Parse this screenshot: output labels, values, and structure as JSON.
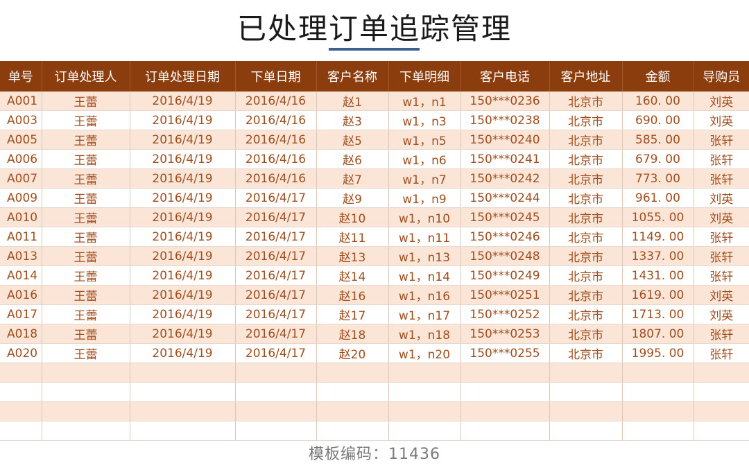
{
  "title": "已处理订单追踪管理",
  "colors": {
    "header_bg": "#8c3d0e",
    "band": "#fbe5d6",
    "text": "#a14e1e",
    "accent_underline": "#3d5f8e"
  },
  "table": {
    "headers": [
      "单号",
      "订单处理人",
      "订单处理日期",
      "下单日期",
      "客户名称",
      "下单明细",
      "客户电话",
      "客户地址",
      "金额",
      "导购员"
    ],
    "rows": [
      [
        "A001",
        "王蕾",
        "2016/4/19",
        "2016/4/16",
        "赵1",
        "w1，n1",
        "150***0236",
        "北京市",
        "160. 00",
        "刘英"
      ],
      [
        "A003",
        "王蕾",
        "2016/4/19",
        "2016/4/16",
        "赵3",
        "w1，n3",
        "150***0238",
        "北京市",
        "690. 00",
        "刘英"
      ],
      [
        "A005",
        "王蕾",
        "2016/4/19",
        "2016/4/16",
        "赵5",
        "w1，n5",
        "150***0240",
        "北京市",
        "585. 00",
        "张轩"
      ],
      [
        "A006",
        "王蕾",
        "2016/4/19",
        "2016/4/16",
        "赵6",
        "w1，n6",
        "150***0241",
        "北京市",
        "679. 00",
        "张轩"
      ],
      [
        "A007",
        "王蕾",
        "2016/4/19",
        "2016/4/16",
        "赵7",
        "w1，n7",
        "150***0242",
        "北京市",
        "773. 00",
        "张轩"
      ],
      [
        "A009",
        "王蕾",
        "2016/4/19",
        "2016/4/17",
        "赵9",
        "w1，n9",
        "150***0244",
        "北京市",
        "961. 00",
        "刘英"
      ],
      [
        "A010",
        "王蕾",
        "2016/4/19",
        "2016/4/17",
        "赵10",
        "w1，n10",
        "150***0245",
        "北京市",
        "1055. 00",
        "刘英"
      ],
      [
        "A011",
        "王蕾",
        "2016/4/19",
        "2016/4/17",
        "赵11",
        "w1，n11",
        "150***0246",
        "北京市",
        "1149. 00",
        "张轩"
      ],
      [
        "A013",
        "王蕾",
        "2016/4/19",
        "2016/4/17",
        "赵13",
        "w1，n13",
        "150***0248",
        "北京市",
        "1337. 00",
        "张轩"
      ],
      [
        "A014",
        "王蕾",
        "2016/4/19",
        "2016/4/17",
        "赵14",
        "w1，n14",
        "150***0249",
        "北京市",
        "1431. 00",
        "张轩"
      ],
      [
        "A016",
        "王蕾",
        "2016/4/19",
        "2016/4/17",
        "赵16",
        "w1，n16",
        "150***0251",
        "北京市",
        "1619. 00",
        "刘英"
      ],
      [
        "A017",
        "王蕾",
        "2016/4/19",
        "2016/4/17",
        "赵17",
        "w1，n17",
        "150***0252",
        "北京市",
        "1713. 00",
        "刘英"
      ],
      [
        "A018",
        "王蕾",
        "2016/4/19",
        "2016/4/17",
        "赵18",
        "w1，n18",
        "150***0253",
        "北京市",
        "1807. 00",
        "张轩"
      ],
      [
        "A020",
        "王蕾",
        "2016/4/19",
        "2016/4/17",
        "赵20",
        "w1，n20",
        "150***0255",
        "北京市",
        "1995. 00",
        "张轩"
      ],
      [
        "",
        "",
        "",
        "",
        "",
        "",
        "",
        "",
        "",
        ""
      ],
      [
        "",
        "",
        "",
        "",
        "",
        "",
        "",
        "",
        "",
        ""
      ],
      [
        "",
        "",
        "",
        "",
        "",
        "",
        "",
        "",
        "",
        ""
      ],
      [
        "",
        "",
        "",
        "",
        "",
        "",
        "",
        "",
        "",
        ""
      ]
    ]
  },
  "footer": "模板编码：11436"
}
